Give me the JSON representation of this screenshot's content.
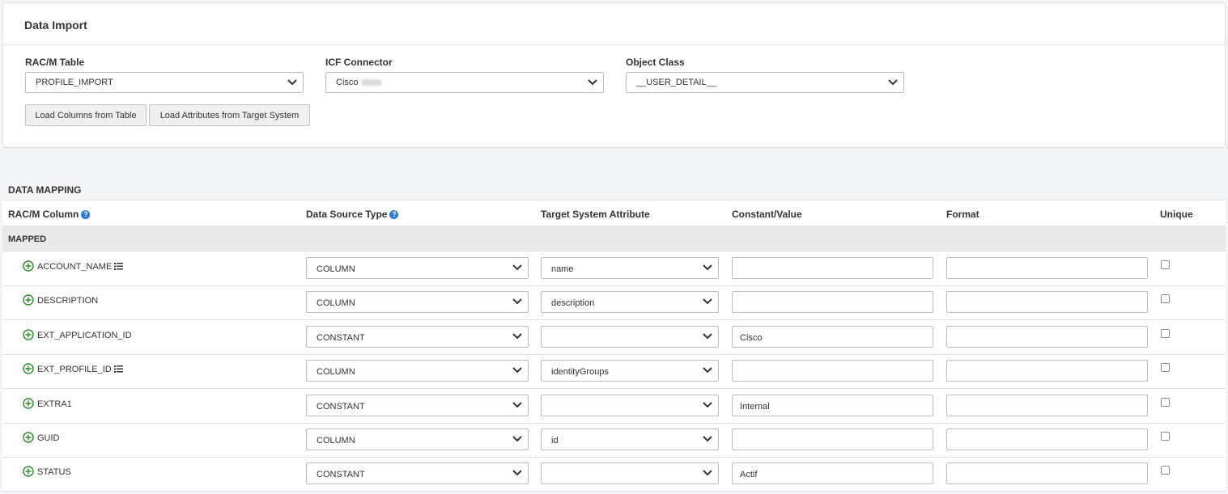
{
  "panel": {
    "title": "Data Import",
    "racm_table": {
      "label": "RAC/M Table",
      "value": "PROFILE_IMPORT"
    },
    "icf_connector": {
      "label": "ICF Connector",
      "value": "Cisco"
    },
    "object_class": {
      "label": "Object Class",
      "value": "__USER_DETAIL__"
    },
    "load_columns_label": "Load Columns from Table",
    "load_attributes_label": "Load Attributes from Target System"
  },
  "mapping": {
    "title": "DATA MAPPING",
    "headers": {
      "racm_column": "RAC/M Column",
      "data_source_type": "Data Source Type",
      "target_attribute": "Target System Attribute",
      "constant_value": "Constant/Value",
      "format": "Format",
      "unique": "Unique"
    },
    "group_label": "MAPPED",
    "rows": [
      {
        "column": "ACCOUNT_NAME",
        "source_type": "COLUMN",
        "target": "name",
        "constant": "",
        "format": ""
      },
      {
        "column": "DESCRIPTION",
        "source_type": "COLUMN",
        "target": "description",
        "constant": "",
        "format": ""
      },
      {
        "column": "EXT_APPLICATION_ID",
        "source_type": "CONSTANT",
        "target": "",
        "constant": "Cisco",
        "format": ""
      },
      {
        "column": "EXT_PROFILE_ID",
        "source_type": "COLUMN",
        "target": "identityGroups",
        "constant": "",
        "format": ""
      },
      {
        "column": "EXTRA1",
        "source_type": "CONSTANT",
        "target": "",
        "constant": "Internal",
        "format": ""
      },
      {
        "column": "GUID",
        "source_type": "COLUMN",
        "target": "id",
        "constant": "",
        "format": ""
      },
      {
        "column": "STATUS",
        "source_type": "CONSTANT",
        "target": "",
        "constant": "Actif",
        "format": ""
      }
    ]
  }
}
